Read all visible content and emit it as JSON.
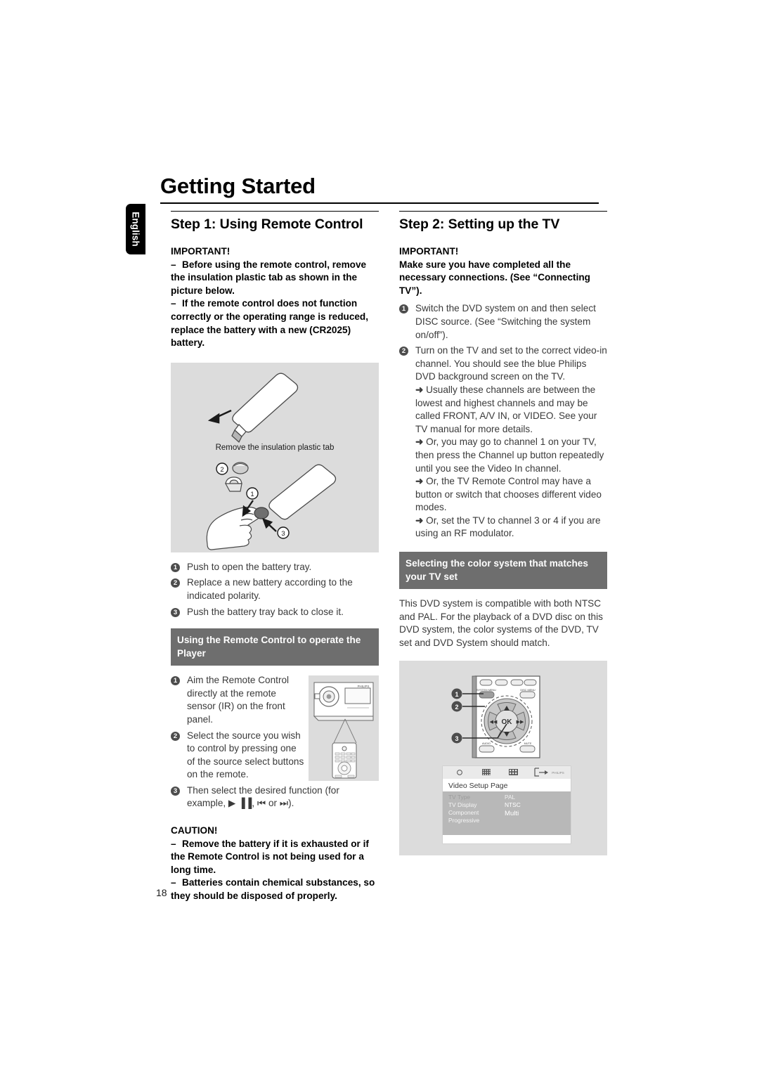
{
  "page": {
    "title": "Getting Started",
    "language_tab": "English",
    "page_number": "18"
  },
  "left_column": {
    "step_heading": "Step 1: Using Remote Control",
    "important_label": "IMPORTANT!",
    "important_items": [
      "Before using the remote control, remove the insulation plastic tab as shown in the picture below.",
      "If the remote control does not function correctly or the operating range is reduced, replace the battery with a new (CR2025) battery."
    ],
    "illustration_caption": "Remove the insulation plastic tab",
    "illustration_callouts": [
      "1",
      "2",
      "3"
    ],
    "battery_steps": [
      "Push to open the battery tray.",
      "Replace a new battery according to the indicated polarity.",
      "Push the battery tray back to close it."
    ],
    "operate_heading": "Using the Remote Control to operate the Player",
    "operate_steps": [
      "Aim the Remote Control directly at the remote sensor (IR) on the front panel.",
      "Select the source you wish to control by pressing one of the source select buttons on the remote.",
      "Then select the desired function (for example, ▶ ▐▐, ⏮  or ⏭)."
    ],
    "front_panel_brand": "PHILIPS",
    "caution_label": "CAUTION!",
    "caution_items": [
      "Remove the battery if it is exhausted or if the Remote Control is not being used for a long time.",
      "Batteries contain chemical substances, so they should be disposed of properly."
    ]
  },
  "right_column": {
    "step_heading": "Step 2: Setting up the TV",
    "important_label": "IMPORTANT!",
    "important_text": "Make sure you have completed all the necessary connections. (See “Connecting TV”).",
    "steps": [
      {
        "num": "1",
        "text": "Switch the DVD system on and then select DISC source. (See “Switching the system on/off”).",
        "arrows": []
      },
      {
        "num": "2",
        "text": "Turn on the TV and set to the correct video-in channel. You should see the blue Philips DVD background screen on the TV.",
        "arrows": [
          "Usually these channels are between the lowest and highest channels and may be called FRONT, A/V IN, or VIDEO. See your TV manual for more details.",
          "Or, you may go to channel 1 on your TV, then press the Channel up button repeatedly until you see the Video In channel.",
          "Or, the TV Remote Control may have a button or switch that chooses different video modes.",
          "Or, set the TV to channel 3 or 4 if you are using an RF modulator."
        ]
      }
    ],
    "color_system_heading": "Selecting the color system that matches your TV set",
    "color_system_text": "This DVD system is compatible with both NTSC and PAL. For the playback of a DVD disc on this DVD system, the color systems of the DVD, TV set and DVD System should match.",
    "remote_diagram": {
      "callouts": [
        "1",
        "2",
        "3"
      ],
      "button_labels": {
        "system_menu": "SYSTEM MENU",
        "disc_menu": "DISC MENU",
        "audio": "AUDIO",
        "mute": "MUTE",
        "ok": "OK"
      }
    },
    "tv_screen": {
      "brand": "PHILIPS",
      "page_title": "Video Setup Page",
      "menu_items": [
        "TV Type",
        "TV Display",
        "Component",
        "Progressive"
      ],
      "menu_values": [
        "PAL",
        "NTSC",
        "Multi"
      ]
    }
  }
}
